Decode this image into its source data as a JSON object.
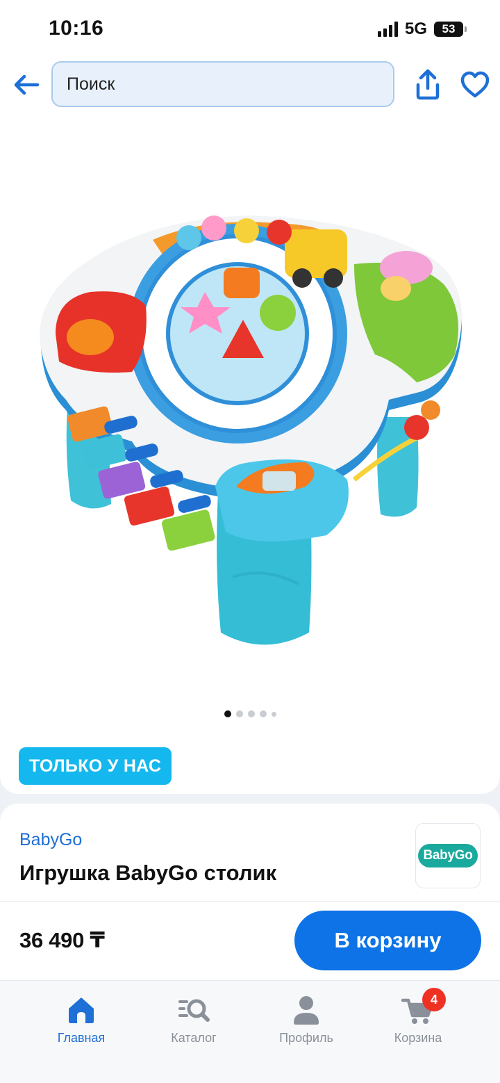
{
  "status_bar": {
    "time": "10:16",
    "network": "5G",
    "battery": "53"
  },
  "header": {
    "search_placeholder": "Поиск",
    "icons": [
      "back-arrow-icon",
      "share-icon",
      "heart-icon"
    ]
  },
  "product": {
    "gallery": {
      "total_images": 5,
      "active_index": 0
    },
    "badge": "ТОЛЬКО У НАС",
    "brand": "BabyGo",
    "brand_logo_text": "BabyGo",
    "title": "Игрушка BabyGo столик",
    "price": "36 490 ₸",
    "add_to_cart_label": "В корзину"
  },
  "tab_bar": {
    "items": [
      {
        "label": "Главная",
        "icon": "home-icon",
        "active": true
      },
      {
        "label": "Каталог",
        "icon": "catalog-search-icon",
        "active": false
      },
      {
        "label": "Профиль",
        "icon": "profile-icon",
        "active": false
      },
      {
        "label": "Корзина",
        "icon": "cart-icon",
        "active": false,
        "badge": "4"
      }
    ]
  },
  "colors": {
    "accent": "#0d73e6",
    "badge_bg": "#14b8ee",
    "brand_logo_bg": "#1aa99d",
    "cart_badge": "#ef3124"
  }
}
